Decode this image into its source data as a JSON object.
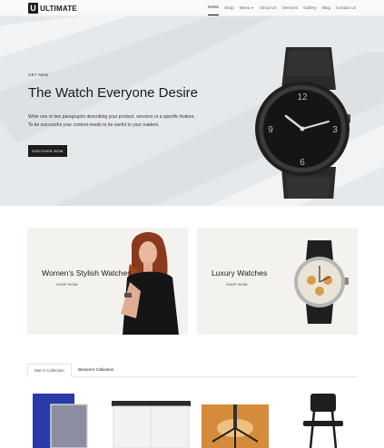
{
  "brand": {
    "logo_letter": "U",
    "name": "ULTIMATE"
  },
  "nav": {
    "items": [
      {
        "label": "Home",
        "active": true
      },
      {
        "label": "Shop"
      },
      {
        "label": "Menu",
        "has_dropdown": true
      },
      {
        "label": "About Us"
      },
      {
        "label": "Services"
      },
      {
        "label": "Gallery"
      },
      {
        "label": "Blog"
      },
      {
        "label": "Contact us"
      }
    ]
  },
  "hero": {
    "eyebrow": "GET NEW",
    "title": "The Watch Everyone Desire",
    "text_line1": "Write one or two paragraphs describing your product, services or a specific feature.",
    "text_line2": "To be successful your content needs to be useful to your readers.",
    "button_label": "DISCOVER NOW"
  },
  "promos": [
    {
      "title": "Women's Stylish Watches",
      "link_label": "SHOP NOW"
    },
    {
      "title": "Luxury Watches",
      "link_label": "SHOP NOW"
    }
  ],
  "tabs": [
    {
      "label": "Men's Collection",
      "active": true
    },
    {
      "label": "Women's Collection",
      "active": false
    }
  ],
  "products": [
    {
      "icon": "blue-panel-product-image"
    },
    {
      "icon": "white-cabinet-product-image"
    },
    {
      "icon": "office-chair-base-product-image"
    },
    {
      "icon": "black-chair-product-image"
    }
  ],
  "colors": {
    "dark": "#1c1c1c",
    "hero_bg": "#e6e9ec",
    "promo_bg": "#f4f2ee",
    "accent_orange": "#e0a060"
  }
}
